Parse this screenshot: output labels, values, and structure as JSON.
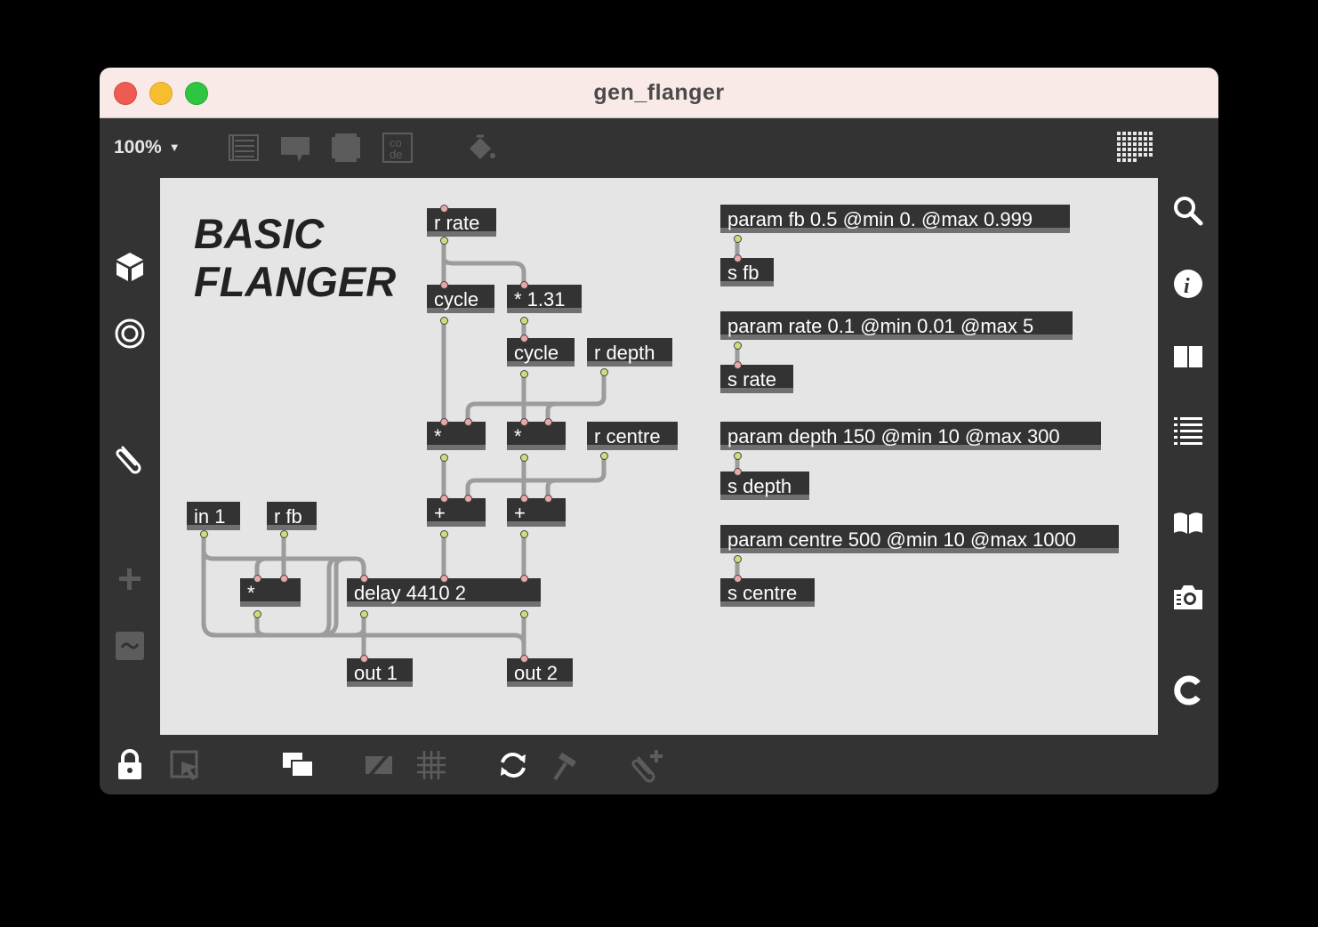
{
  "window": {
    "title": "gen_flanger"
  },
  "toolbar": {
    "zoom": "100%",
    "icons": [
      "presentation-icon",
      "comment-icon",
      "bpatcher-icon",
      "codebox-icon",
      "paint-bucket-icon",
      "grid-keyboard-icon"
    ]
  },
  "left_sidebar": {
    "icons": [
      "cube-icon",
      "target-icon",
      "paperclip-icon",
      "plus-icon",
      "tilde-icon"
    ]
  },
  "right_sidebar": {
    "icons": [
      "search-icon",
      "info-icon",
      "split-view-icon",
      "list-icon",
      "book-icon",
      "camera-icon",
      "c-icon"
    ]
  },
  "bottom_bar": {
    "icons": [
      "lock-icon",
      "select-icon",
      "windows-icon",
      "hide-icon",
      "grid-icon",
      "refresh-icon",
      "hammer-icon",
      "paperclip-add-icon"
    ]
  },
  "patch": {
    "comment": {
      "line1": "BASIC",
      "line2": "FLANGER"
    },
    "objects": {
      "r_rate": "r rate",
      "cycle1": "cycle",
      "mul131": "* 1.31",
      "cycle2": "cycle",
      "r_depth": "r depth",
      "mul1": "*",
      "mul2": "*",
      "r_centre": "r centre",
      "in1": "in 1",
      "r_fb": "r fb",
      "add1": "+",
      "add2": "+",
      "mul_fb": "*",
      "delay": "delay 4410 2",
      "out1": "out 1",
      "out2": "out 2",
      "param_fb": "param fb 0.5 @min 0. @max 0.999",
      "s_fb": "s fb",
      "param_rate": "param rate 0.1 @min 0.01 @max 5",
      "s_rate": "s rate",
      "param_depth": "param depth 150 @min 10 @max 300",
      "s_depth": "s depth",
      "param_centre": "param centre 500 @min 10 @max 1000",
      "s_centre": "s centre"
    }
  },
  "colors": {
    "window_bg": "#333333",
    "titlebar": "#f9e9e7",
    "canvas": "#e5e5e5",
    "object_bg": "#333333",
    "inlet": "#e8a8a8",
    "outlet": "#c9e07a",
    "patchcord": "#9a9a9a"
  }
}
